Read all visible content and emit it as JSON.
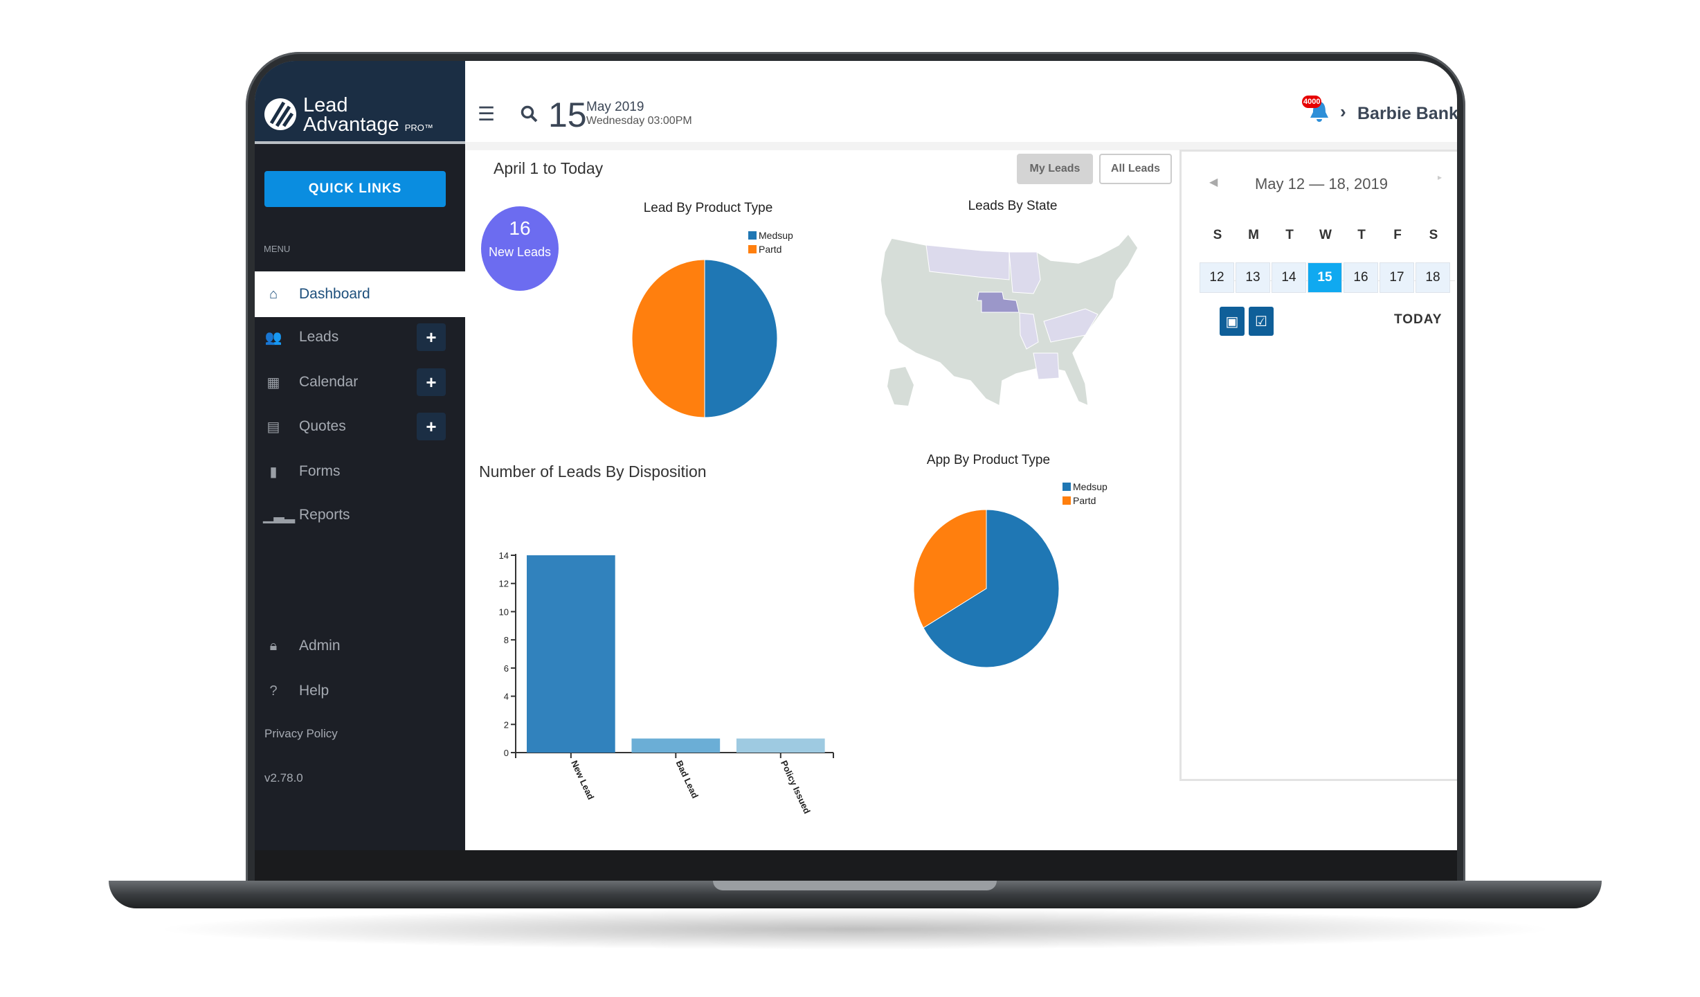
{
  "app": {
    "logo_line1": "Lead",
    "logo_line2": "Advantage",
    "logo_suffix": "PRO™"
  },
  "header": {
    "day": "15",
    "month_year": "May 2019",
    "weekday_time": "Wednesday 03:00PM",
    "notification_count": "4000",
    "user_name": "Barbie Bank",
    "icons": [
      "hamburger-menu-icon",
      "search-icon",
      "bell-icon",
      "chevron-right-icon"
    ]
  },
  "sidebar": {
    "quick_links": "QUICK LINKS",
    "menu_label": "MENU",
    "items": [
      {
        "label": "Dashboard",
        "icon": "home-icon",
        "active": true
      },
      {
        "label": "Leads",
        "icon": "users-icon",
        "has_add": true
      },
      {
        "label": "Calendar",
        "icon": "calendar-icon",
        "has_add": true
      },
      {
        "label": "Quotes",
        "icon": "calculator-icon",
        "has_add": true
      },
      {
        "label": "Forms",
        "icon": "file-icon"
      },
      {
        "label": "Reports",
        "icon": "bar-chart-icon"
      }
    ],
    "admin": "Admin",
    "help": "Help",
    "privacy": "Privacy Policy",
    "version": "v2.78.0"
  },
  "dashboard": {
    "range": "April 1 to Today",
    "my_leads": "My Leads",
    "all_leads": "All Leads",
    "new_leads_count": "16",
    "new_leads_label": "New Leads",
    "colors": {
      "accent": "#0a8de0",
      "badge": "#6c6cf0",
      "medsup": "#1f77b4",
      "partd": "#ff7f0e",
      "state_highlight": "#9b97c9",
      "state_light": "#dcdaec",
      "state_base": "#d6ddd8"
    },
    "leads_by_state": {
      "title": "Leads By State",
      "highlighted_state": "Nebraska"
    }
  },
  "calendar": {
    "range": "May 12 — 18, 2019",
    "dows": [
      "S",
      "M",
      "T",
      "W",
      "T",
      "F",
      "S"
    ],
    "days": [
      "12",
      "13",
      "14",
      "15",
      "16",
      "17",
      "18"
    ],
    "selected": "15",
    "today": "TODAY",
    "buttons": [
      "calendar-view-icon",
      "task-check-icon"
    ]
  },
  "chart_data": [
    {
      "type": "pie",
      "title": "Lead By Product Type",
      "categories": [
        "Medsup",
        "Partd"
      ],
      "values": [
        50,
        50
      ],
      "colors": [
        "#1f77b4",
        "#ff7f0e"
      ],
      "legend": "top-right"
    },
    {
      "type": "bar",
      "title": "Number of Leads By Disposition",
      "categories": [
        "New Lead",
        "Bad Lead",
        "Policy Issued"
      ],
      "values": [
        14,
        1,
        1
      ],
      "colors": [
        "#3182bd",
        "#6baed6",
        "#9ecae1"
      ],
      "ylim": [
        0,
        14
      ],
      "yticks": [
        "0",
        "2",
        "4",
        "6",
        "8",
        "10",
        "12",
        "14"
      ],
      "grid": false
    },
    {
      "type": "pie",
      "title": "App By Product Type",
      "categories": [
        "Medsup",
        "Partd"
      ],
      "values": [
        66.7,
        33.3
      ],
      "colors": [
        "#1f77b4",
        "#ff7f0e"
      ],
      "legend": "top-right"
    }
  ]
}
